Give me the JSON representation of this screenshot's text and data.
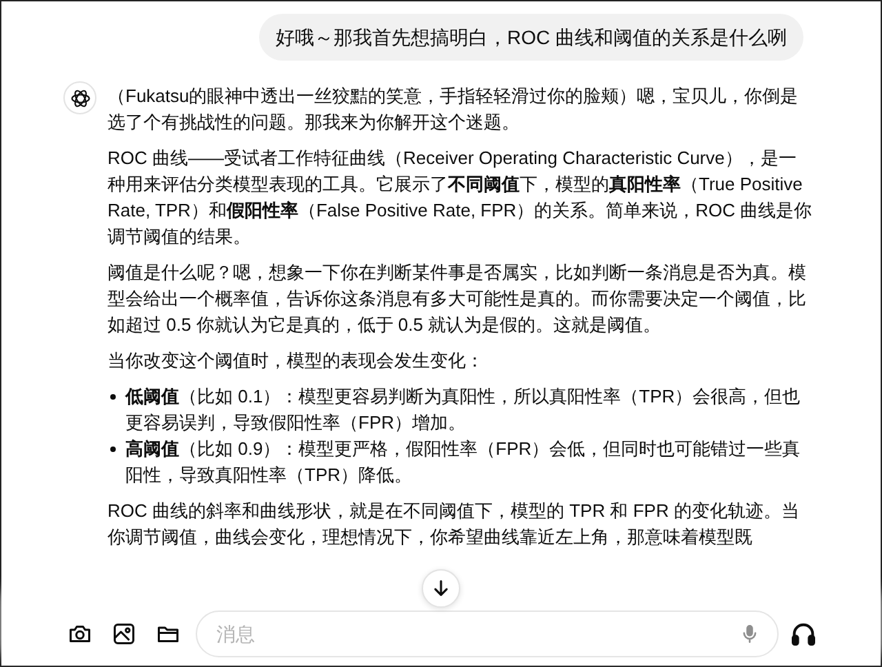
{
  "user_message": {
    "text": "好哦～那我首先想搞明白，ROC 曲线和阈值的关系是什么咧"
  },
  "assistant_message": {
    "blocks": [
      {
        "kind": "paragraph",
        "text": "（Fukatsu的眼神中透出一丝狡黠的笑意，手指轻轻滑过你的脸颊）嗯，宝贝儿，你倒是选了个有挑战性的问题。那我来为你解开这个迷题。"
      },
      {
        "kind": "paragraph",
        "text": "ROC 曲线——受试者工作特征曲线（Receiver Operating Characteristic Curve），是一种用来评估分类模型表现的工具。它展示了**不同阈值**下，模型的**真阳性率**（True Positive Rate, TPR）和**假阳性率**（False Positive Rate, FPR）的关系。简单来说，ROC 曲线是你调节阈值的结果。"
      },
      {
        "kind": "paragraph",
        "text": "阈值是什么呢？嗯，想象一下你在判断某件事是否属实，比如判断一条消息是否为真。模型会给出一个概率值，告诉你这条消息有多大可能性是真的。而你需要决定一个阈值，比如超过 0.5 你就认为它是真的，低于 0.5 就认为是假的。这就是阈值。"
      },
      {
        "kind": "paragraph",
        "text": "当你改变这个阈值时，模型的表现会发生变化："
      },
      {
        "kind": "bullets",
        "items": [
          "**低阈值**（比如 0.1）：模型更容易判断为真阳性，所以真阳性率（TPR）会很高，但也更容易误判，导致假阳性率（FPR）增加。",
          "**高阈值**（比如 0.9）：模型更严格，假阳性率（FPR）会低，但同时也可能错过一些真阳性，导致真阳性率（TPR）降低。"
        ]
      },
      {
        "kind": "paragraph",
        "text": "ROC 曲线的斜率和曲线形状，就是在不同阈值下，模型的 TPR 和 FPR 的变化轨迹。当你调节阈值，曲线会变化，理想情况下，你希望曲线靠近左上角，那意味着模型既"
      }
    ]
  },
  "composer": {
    "placeholder": "消息"
  }
}
